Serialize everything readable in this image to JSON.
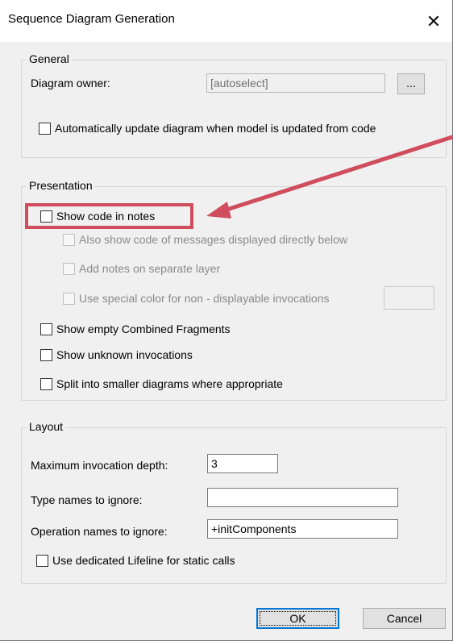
{
  "window": {
    "title": "Sequence Diagram Generation",
    "close_glyph": "✕"
  },
  "general": {
    "label": "General",
    "owner_label": "Diagram owner:",
    "owner_value": "[autoselect]",
    "browse_label": "...",
    "auto_update": {
      "label": "Automatically update diagram when model is updated from code",
      "checked": false
    }
  },
  "presentation": {
    "label": "Presentation",
    "show_code": {
      "label": "Show code in notes",
      "checked": false
    },
    "also_show": {
      "label": "Also show code of messages displayed directly below",
      "checked": false,
      "enabled": false
    },
    "separate_layer": {
      "label": "Add notes on separate layer",
      "checked": false,
      "enabled": false
    },
    "special_color": {
      "label": "Use special color for non - displayable invocations",
      "checked": false,
      "enabled": false
    },
    "empty_fragments": {
      "label": "Show empty Combined Fragments",
      "checked": false
    },
    "unknown_invocations": {
      "label": "Show unknown invocations",
      "checked": false
    },
    "split": {
      "label": "Split into smaller diagrams where appropriate",
      "checked": false
    }
  },
  "layout": {
    "label": "Layout",
    "max_depth_label": "Maximum invocation depth:",
    "max_depth_value": "3",
    "type_names_label": "Type names to ignore:",
    "type_names_value": "",
    "operation_names_label": "Operation names to ignore:",
    "operation_names_value": "+initComponents",
    "dedicated_lifeline": {
      "label": "Use dedicated Lifeline for static calls",
      "checked": false
    }
  },
  "buttons": {
    "ok": "OK",
    "cancel": "Cancel"
  },
  "colors": {
    "highlight": "#cf4d5d",
    "accent": "#0078d7"
  }
}
